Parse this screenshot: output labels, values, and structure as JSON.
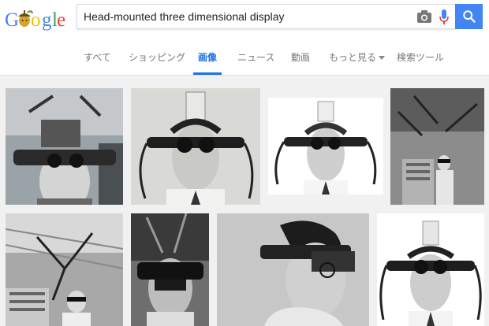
{
  "logo": {
    "text": "Google"
  },
  "search": {
    "query": "Head-mounted three dimensional display"
  },
  "tabs": [
    {
      "label": "すべて",
      "active": false
    },
    {
      "label": "ショッピング",
      "active": false
    },
    {
      "label": "画像",
      "active": true
    },
    {
      "label": "ニュース",
      "active": false
    },
    {
      "label": "動画",
      "active": false
    },
    {
      "label": "もっと見る",
      "active": false
    },
    {
      "label": "検索ツール",
      "active": false
    }
  ],
  "colors": {
    "accent": "#4285f4",
    "active_tab": "#1a73e8",
    "logo_g": "#4285f4",
    "logo_e": "#ea4335"
  },
  "icons": [
    "camera-icon",
    "microphone-icon",
    "search-icon",
    "acorn-doodle-icon"
  ],
  "results": {
    "row1_count": 4,
    "row2_count": 4
  }
}
